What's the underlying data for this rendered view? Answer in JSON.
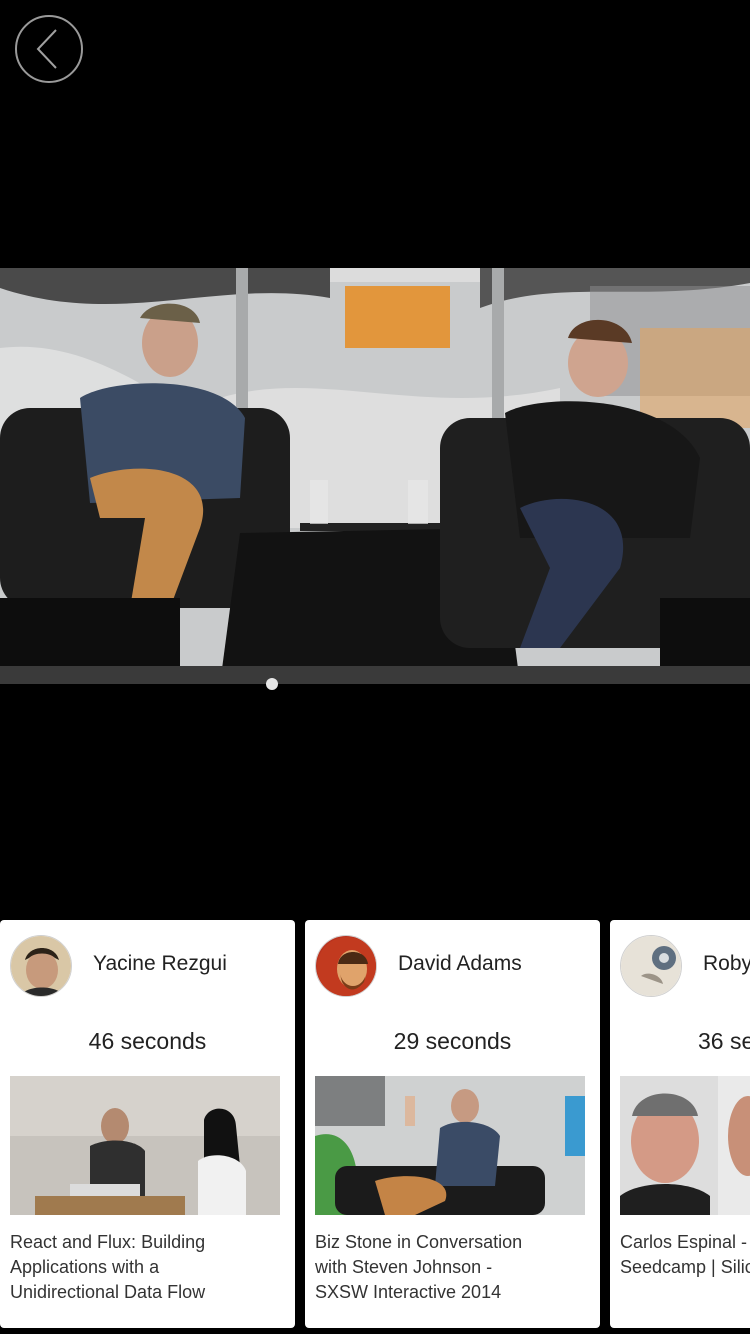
{
  "nav": {
    "back_icon": "chevron-left-icon"
  },
  "video": {
    "description_icon": "video-frame"
  },
  "cards": [
    {
      "user": "Yacine Rezgui",
      "duration": "46 seconds",
      "title": "React and Flux: Building\nApplications with a\nUnidirectional Data Flow"
    },
    {
      "user": "David Adams",
      "duration": "29 seconds",
      "title": "Biz Stone in Conversation\nwith Steven Johnson -\nSXSW Interactive 2014"
    },
    {
      "user": "Roby",
      "duration": "36 se",
      "title": "Carlos Espinal -\nSeedcamp | Silic"
    }
  ],
  "colors": {
    "background": "#000000",
    "card": "#ffffff",
    "text": "#222222"
  }
}
